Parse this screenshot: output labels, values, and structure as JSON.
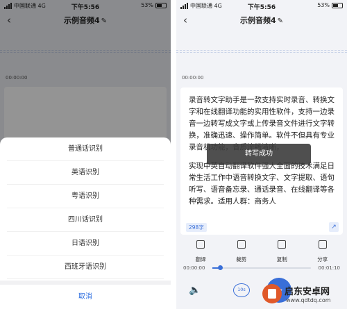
{
  "status": {
    "carrier": "中国联通",
    "network": "4G",
    "time": "下午5:56",
    "battery": "53%"
  },
  "nav": {
    "title": "示例音频4",
    "back_icon": "chevron-left-icon",
    "edit_icon": "pencil-icon"
  },
  "timeline_start": "00:00:00",
  "sheet": {
    "options": [
      "普通话识别",
      "英语识别",
      "粤语识别",
      "四川话识别",
      "日语识别",
      "西班牙语识别"
    ],
    "cancel": "取消"
  },
  "transcript": {
    "paragraph1": "录音转文字助手是一款支持实时录音、转换文字和在线翻译功能的实用性软件，支持一边录音一边转写成文字或上传录音文件进行文字转换，准确迅速、操作简单。软件不但具有专业录音机功能，音质流畅清晰，",
    "paragraph2": "实现中英自动翻译软件强大全面的技术满足日常生活工作中语音转换文字、文字提取、语句听写、语音备忘录、通话录音、在线翻译等各种需求。适用人群：商务人",
    "word_count": "298字",
    "toast": "转写成功"
  },
  "toolbar": {
    "translate": "翻译",
    "clip": "裁剪",
    "copy": "复制",
    "share": "分享"
  },
  "player": {
    "current": "00:00:00",
    "total": "00:01:10",
    "progress": 0.08,
    "rewind_label": "10s"
  },
  "watermark": {
    "name": "启东安卓网",
    "url": "www.qdtdq.com"
  },
  "colors": {
    "accent": "#3a6fd8",
    "cancel": "#2f6fe0"
  }
}
